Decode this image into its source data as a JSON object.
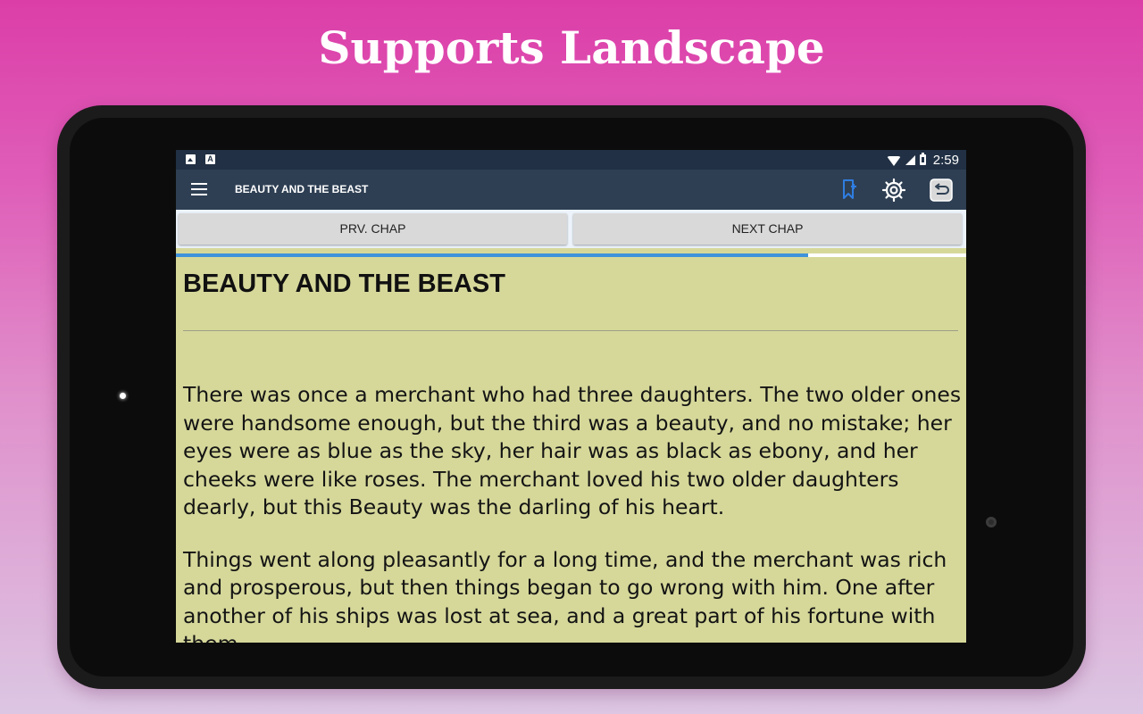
{
  "promo": {
    "headline": "Supports Landscape"
  },
  "status_bar": {
    "time": "2:59",
    "notification_icons": [
      "image-icon",
      "text-icon"
    ],
    "notification_text_glyph": "A",
    "system_icons": [
      "wifi-icon",
      "signal-icon",
      "battery-icon"
    ]
  },
  "app_bar": {
    "title": "BEAUTY AND THE BEAST",
    "actions": [
      "bookmark-icon",
      "gear-icon",
      "undo-icon"
    ],
    "bookmark_color": "#2f7de1"
  },
  "chapter_nav": {
    "prev_label": "PRV. CHAP",
    "next_label": "NEXT CHAP"
  },
  "reading_progress": {
    "fraction": 0.8
  },
  "content": {
    "heading": "BEAUTY AND THE BEAST",
    "paragraphs": [
      "There was once a merchant who had three daughters. The two older ones were handsome enough, but the third was a beauty, and no mistake; her eyes were as blue as the sky, her hair was as black as ebony, and her cheeks were like roses. The merchant loved his two older daughters dearly, but this Beauty was the darling of his heart.",
      "Things went along pleasantly for a long time, and the merchant was rich and prosperous, but then things began to go wrong with him. One after another of his ships was lost at sea, and a great part of his fortune with them."
    ]
  },
  "colors": {
    "background_top": "#dc3ea8",
    "background_bottom": "#dcc6e3",
    "status_bar": "#213044",
    "app_bar": "#2e3f53",
    "page_background": "#d6d89a",
    "progress": "#3f93db"
  }
}
